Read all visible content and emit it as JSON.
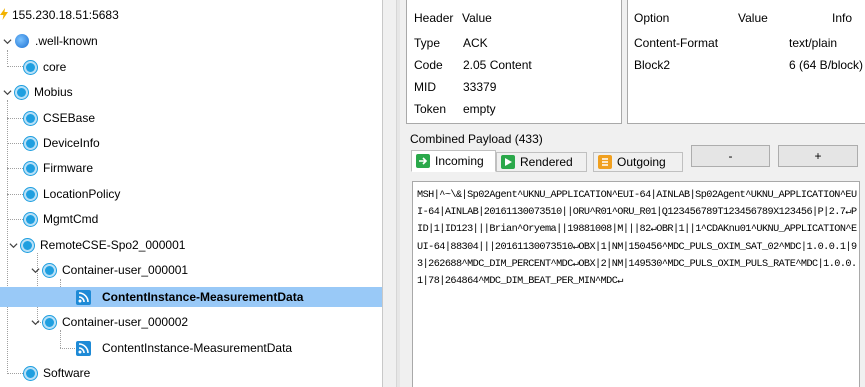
{
  "tree": {
    "root": "155.230.18.51:5683",
    "well_known": ".well-known",
    "core": "core",
    "mobius": "Mobius",
    "csebase": "CSEBase",
    "deviceinfo": "DeviceInfo",
    "firmware": "Firmware",
    "locationpolicy": "LocationPolicy",
    "mgmtcmd": "MgmtCmd",
    "remotecse": "RemoteCSE-Spo2_000001",
    "container1": "Container-user_000001",
    "ci1": "ContentInstance-MeasurementData",
    "container2": "Container-user_000002",
    "ci2": "ContentInstance-MeasurementData",
    "software": "Software"
  },
  "header_table": {
    "col_header": "Header",
    "col_value": "Value",
    "rows": [
      {
        "key": "Type",
        "value": "ACK"
      },
      {
        "key": "Code",
        "value": "2.05 Content"
      },
      {
        "key": "MID",
        "value": "33379"
      },
      {
        "key": "Token",
        "value": "empty"
      }
    ]
  },
  "option_table": {
    "col_option": "Option",
    "col_value": "Value",
    "col_info": "Info",
    "rows": [
      {
        "option": "Content-Format",
        "value": "",
        "info": "text/plain"
      },
      {
        "option": "Block2",
        "value": "",
        "info": "6 (64 B/block)"
      }
    ]
  },
  "payload": {
    "label": "Combined Payload (433)",
    "tabs": {
      "incoming": "Incoming",
      "rendered": "Rendered",
      "outgoing": "Outgoing"
    },
    "minus": "-",
    "plus": "+",
    "text": "MSH|^~\\&|Sp02Agent^UKNU_APPLICATION^EUI-64|AINLAB|Sp02Agent^UKNU_APPLICATION^EUI-64|AINLAB|20161130073510||ORU^R01^ORU_R01|Q123456789T123456789X123456|P|2.7↵PID|1|ID123|||Brian^Oryema||19881008|M|||82↵OBR|1||1^CDAKnu01^UKNU_APPLICATION^EUI-64|88304|||20161130073510↵OBX|1|NM|150456^MDC_PULS_OXIM_SAT_02^MDC|1.0.0.1|93|262688^MDC_DIM_PERCENT^MDC↵OBX|2|NM|149530^MDC_PULS_OXIM_PULS_RATE^MDC|1.0.0.1|78|264864^MDC_DIM_BEAT_PER_MIN^MDC↵"
  },
  "colors": {
    "selection": "#99c9f7",
    "resource_icon": "#1f9fe0",
    "tab_incoming": "#2aa84a",
    "tab_rendered": "#2aa84a",
    "tab_outgoing": "#f0a020"
  }
}
